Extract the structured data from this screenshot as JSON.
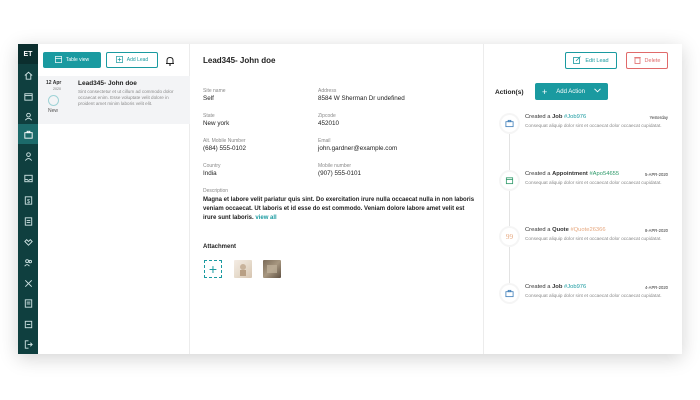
{
  "sidebar": {
    "logo": "ET",
    "icons": [
      "home-icon",
      "calendar-icon",
      "contacts-icon",
      "briefcase-icon",
      "person-icon",
      "inbox-icon",
      "dollar-icon",
      "document-icon",
      "handshake-icon",
      "team-icon",
      "tools-icon",
      "list-icon",
      "settings-icon",
      "logout-icon"
    ]
  },
  "list": {
    "table_view_label": "Table view",
    "add_lead_label": "Add Lead",
    "item": {
      "date": "12 Apr",
      "year": "2020",
      "status": "New",
      "name": "Lead345- John doe",
      "desc": "Sint consectetur et ut cillum ad commodo dolor occaecat enim. Esse voluptate velit dolore in proident amet minim laboris velit elit."
    }
  },
  "detail": {
    "title": "Lead345- John doe",
    "fields": {
      "site_name": {
        "label": "Site name",
        "value": "Self"
      },
      "address": {
        "label": "Address",
        "value": "8584 W Sherman Dr undefined"
      },
      "state": {
        "label": "State",
        "value": "New york"
      },
      "zipcode": {
        "label": "Zipcode",
        "value": "452010"
      },
      "alt_mobile": {
        "label": "Alt. Mobile Number",
        "value": "(684) 555-0102"
      },
      "email": {
        "label": "Email",
        "value": "john.gardner@example.com"
      },
      "country": {
        "label": "Country",
        "value": "India"
      },
      "mobile": {
        "label": "Mobile number",
        "value": "(907) 555-0101"
      }
    },
    "description_label": "Description",
    "description": "Magna et labore velit pariatur quis sint. Do exercitation irure nulla occaecat nulla in non laboris veniam occaecat. Ut laboris et id esse do est commodo. Veniam dolore labore amet velit est irure sunt laboris.",
    "view_all": "view all",
    "attachment_label": "Attachment",
    "add_attachment": "+"
  },
  "actions": {
    "edit_label": "Edit Lead",
    "delete_label": "Delete",
    "title": "Action(s)",
    "add_action_label": "Add Action",
    "items": [
      {
        "prefix": "Created a ",
        "type": "Job",
        "ref": "#Job976",
        "date": "Yesterday",
        "desc": "Consequat aliquip dolor sint et occaecat dolor occaecat cupidatat."
      },
      {
        "prefix": "Created a ",
        "type": "Appointment",
        "ref": "#Apo54655",
        "date": "5-APR-2020",
        "desc": "Consequat aliquip dolor sint et occaecat dolor occaecat cupidatat."
      },
      {
        "prefix": "Created a ",
        "type": "Quote",
        "ref": "#Quote26366",
        "date": "8-APR-2020",
        "desc": "Consequat aliquip dolor sint et occaecat dolor occaecat cupidatat."
      },
      {
        "prefix": "Created a ",
        "type": "Job",
        "ref": "#Job976",
        "date": "4-APR-2020",
        "desc": "Consequat aliquip dolor sint et occaecat dolor occaecat cupidatat."
      }
    ]
  },
  "colors": {
    "accent": "#1a9aa0",
    "sidebar": "#0f3f3f",
    "delete": "#e06a6a",
    "appointment": "#2f9a6a",
    "quote": "#e6a77e"
  }
}
